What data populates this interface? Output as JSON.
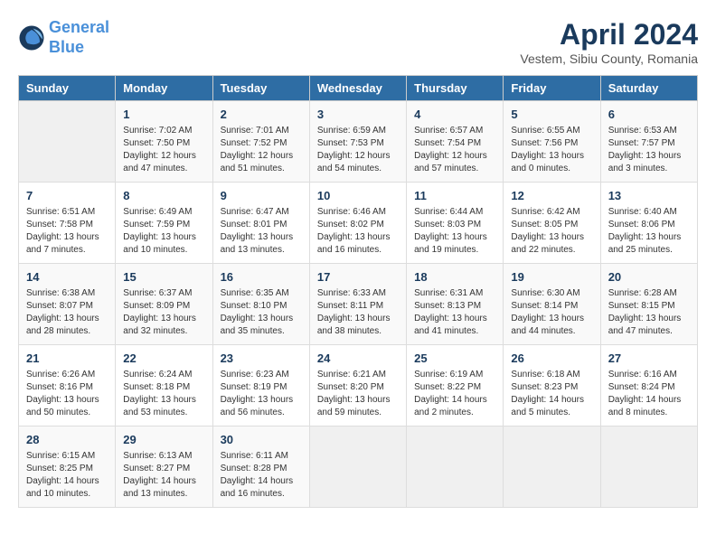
{
  "logo": {
    "line1": "General",
    "line2": "Blue"
  },
  "title": "April 2024",
  "subtitle": "Vestem, Sibiu County, Romania",
  "weekdays": [
    "Sunday",
    "Monday",
    "Tuesday",
    "Wednesday",
    "Thursday",
    "Friday",
    "Saturday"
  ],
  "weeks": [
    [
      {
        "day": "",
        "info": ""
      },
      {
        "day": "1",
        "info": "Sunrise: 7:02 AM\nSunset: 7:50 PM\nDaylight: 12 hours\nand 47 minutes."
      },
      {
        "day": "2",
        "info": "Sunrise: 7:01 AM\nSunset: 7:52 PM\nDaylight: 12 hours\nand 51 minutes."
      },
      {
        "day": "3",
        "info": "Sunrise: 6:59 AM\nSunset: 7:53 PM\nDaylight: 12 hours\nand 54 minutes."
      },
      {
        "day": "4",
        "info": "Sunrise: 6:57 AM\nSunset: 7:54 PM\nDaylight: 12 hours\nand 57 minutes."
      },
      {
        "day": "5",
        "info": "Sunrise: 6:55 AM\nSunset: 7:56 PM\nDaylight: 13 hours\nand 0 minutes."
      },
      {
        "day": "6",
        "info": "Sunrise: 6:53 AM\nSunset: 7:57 PM\nDaylight: 13 hours\nand 3 minutes."
      }
    ],
    [
      {
        "day": "7",
        "info": "Sunrise: 6:51 AM\nSunset: 7:58 PM\nDaylight: 13 hours\nand 7 minutes."
      },
      {
        "day": "8",
        "info": "Sunrise: 6:49 AM\nSunset: 7:59 PM\nDaylight: 13 hours\nand 10 minutes."
      },
      {
        "day": "9",
        "info": "Sunrise: 6:47 AM\nSunset: 8:01 PM\nDaylight: 13 hours\nand 13 minutes."
      },
      {
        "day": "10",
        "info": "Sunrise: 6:46 AM\nSunset: 8:02 PM\nDaylight: 13 hours\nand 16 minutes."
      },
      {
        "day": "11",
        "info": "Sunrise: 6:44 AM\nSunset: 8:03 PM\nDaylight: 13 hours\nand 19 minutes."
      },
      {
        "day": "12",
        "info": "Sunrise: 6:42 AM\nSunset: 8:05 PM\nDaylight: 13 hours\nand 22 minutes."
      },
      {
        "day": "13",
        "info": "Sunrise: 6:40 AM\nSunset: 8:06 PM\nDaylight: 13 hours\nand 25 minutes."
      }
    ],
    [
      {
        "day": "14",
        "info": "Sunrise: 6:38 AM\nSunset: 8:07 PM\nDaylight: 13 hours\nand 28 minutes."
      },
      {
        "day": "15",
        "info": "Sunrise: 6:37 AM\nSunset: 8:09 PM\nDaylight: 13 hours\nand 32 minutes."
      },
      {
        "day": "16",
        "info": "Sunrise: 6:35 AM\nSunset: 8:10 PM\nDaylight: 13 hours\nand 35 minutes."
      },
      {
        "day": "17",
        "info": "Sunrise: 6:33 AM\nSunset: 8:11 PM\nDaylight: 13 hours\nand 38 minutes."
      },
      {
        "day": "18",
        "info": "Sunrise: 6:31 AM\nSunset: 8:13 PM\nDaylight: 13 hours\nand 41 minutes."
      },
      {
        "day": "19",
        "info": "Sunrise: 6:30 AM\nSunset: 8:14 PM\nDaylight: 13 hours\nand 44 minutes."
      },
      {
        "day": "20",
        "info": "Sunrise: 6:28 AM\nSunset: 8:15 PM\nDaylight: 13 hours\nand 47 minutes."
      }
    ],
    [
      {
        "day": "21",
        "info": "Sunrise: 6:26 AM\nSunset: 8:16 PM\nDaylight: 13 hours\nand 50 minutes."
      },
      {
        "day": "22",
        "info": "Sunrise: 6:24 AM\nSunset: 8:18 PM\nDaylight: 13 hours\nand 53 minutes."
      },
      {
        "day": "23",
        "info": "Sunrise: 6:23 AM\nSunset: 8:19 PM\nDaylight: 13 hours\nand 56 minutes."
      },
      {
        "day": "24",
        "info": "Sunrise: 6:21 AM\nSunset: 8:20 PM\nDaylight: 13 hours\nand 59 minutes."
      },
      {
        "day": "25",
        "info": "Sunrise: 6:19 AM\nSunset: 8:22 PM\nDaylight: 14 hours\nand 2 minutes."
      },
      {
        "day": "26",
        "info": "Sunrise: 6:18 AM\nSunset: 8:23 PM\nDaylight: 14 hours\nand 5 minutes."
      },
      {
        "day": "27",
        "info": "Sunrise: 6:16 AM\nSunset: 8:24 PM\nDaylight: 14 hours\nand 8 minutes."
      }
    ],
    [
      {
        "day": "28",
        "info": "Sunrise: 6:15 AM\nSunset: 8:25 PM\nDaylight: 14 hours\nand 10 minutes."
      },
      {
        "day": "29",
        "info": "Sunrise: 6:13 AM\nSunset: 8:27 PM\nDaylight: 14 hours\nand 13 minutes."
      },
      {
        "day": "30",
        "info": "Sunrise: 6:11 AM\nSunset: 8:28 PM\nDaylight: 14 hours\nand 16 minutes."
      },
      {
        "day": "",
        "info": ""
      },
      {
        "day": "",
        "info": ""
      },
      {
        "day": "",
        "info": ""
      },
      {
        "day": "",
        "info": ""
      }
    ]
  ]
}
